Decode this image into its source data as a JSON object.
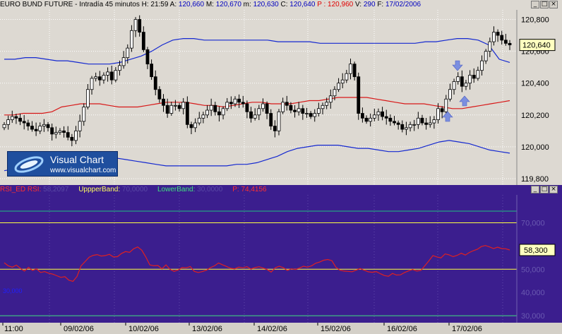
{
  "header": {
    "instrument": "EURO BUND FUTURE",
    "interval": "- Intradía 45 minutos",
    "h_label": "H:",
    "h_value": "21:59",
    "a_label": "A:",
    "a_value": "120,660",
    "mx_label": "M:",
    "mx_value": "120,670",
    "mn_label": "m:",
    "mn_value": "120,630",
    "c_label": "C:",
    "c_value": "120,640",
    "p_label": "P :",
    "p_value": "120,960",
    "v_label": "V:",
    "v_value": "290",
    "f_label": "F:",
    "f_value": "17/02/2006"
  },
  "window_buttons": [
    "_",
    "□",
    "×"
  ],
  "price_axis": {
    "ticks": [
      "120,800",
      "120,600",
      "120,400",
      "120,200",
      "120,000",
      "119,800"
    ],
    "last": "120,640"
  },
  "rsi_header": {
    "name": "RSI_ED",
    "rsi_label": "RSI:",
    "rsi_value": "58,2097",
    "upper_label": "UppperBand:",
    "upper_value": "70,0000",
    "lower_label": "LowerBand:",
    "lower_value": "30,0000",
    "p_label": "P:",
    "p_value": "74,4156"
  },
  "rsi_axis": {
    "ticks": [
      "70,000",
      "50,000",
      "40,000",
      "30,000"
    ],
    "last": "58,300"
  },
  "rsi_side_label": "30,000",
  "x_axis": {
    "labels": [
      "11:00",
      "09/02/06",
      "10/02/06",
      "13/02/06",
      "14/02/06",
      "15/02/06",
      "16/02/06",
      "17/02/06"
    ]
  },
  "logo": {
    "name": "Visual Chart",
    "url": "www.visualchart.com"
  },
  "colors": {
    "upper_band": "#1428d0",
    "mid_band": "#d81818",
    "rsi_line": "#e02020",
    "rsi_bg": "#3b1e8e",
    "up_arrow": "#7b8fe0"
  },
  "chart_data": [
    {
      "type": "candlestick",
      "title": "EURO BUND FUTURE - Intradía 45 minutos",
      "ylim": [
        119.76,
        120.86
      ],
      "series": [
        {
          "name": "price",
          "values": [
            120.14,
            120.17,
            120.19,
            120.18,
            120.16,
            120.15,
            120.13,
            120.11,
            120.1,
            120.13,
            120.14,
            120.12,
            120.08,
            120.09,
            120.1,
            120.09,
            120.06,
            120.04,
            120.1,
            120.16,
            120.25,
            120.36,
            120.43,
            120.44,
            120.42,
            120.45,
            120.47,
            120.42,
            120.48,
            120.51,
            120.56,
            120.62,
            120.73,
            120.8,
            120.72,
            120.61,
            120.52,
            120.44,
            120.36,
            120.3,
            120.26,
            120.21,
            120.26,
            120.26,
            120.24,
            120.28,
            120.14,
            120.12,
            120.15,
            120.18,
            120.2,
            120.23,
            120.26,
            120.22,
            120.2,
            120.24,
            120.28,
            120.27,
            120.3,
            120.28,
            120.27,
            120.22,
            120.18,
            120.2,
            120.24,
            120.27,
            120.21,
            120.13,
            120.1,
            120.22,
            120.28,
            120.26,
            120.23,
            120.22,
            120.24,
            120.21,
            120.21,
            120.19,
            120.21,
            120.24,
            120.26,
            120.28,
            120.32,
            120.36,
            120.4,
            120.42,
            120.46,
            120.52,
            120.44,
            120.21,
            120.18,
            120.16,
            120.18,
            120.2,
            120.22,
            120.19,
            120.18,
            120.16,
            120.15,
            120.14,
            120.11,
            120.12,
            120.14,
            120.14,
            120.18,
            120.15,
            120.14,
            120.15,
            120.17,
            120.24,
            120.22,
            120.3,
            120.36,
            120.41,
            120.44,
            120.38,
            120.4,
            120.45,
            120.43,
            120.48,
            120.54,
            120.6,
            120.66,
            120.72,
            120.7,
            120.67,
            120.65,
            120.64
          ]
        },
        {
          "name": "upper_band",
          "values": [
            120.55,
            120.55,
            120.56,
            120.56,
            120.55,
            120.54,
            120.54,
            120.53,
            120.52,
            120.52,
            120.52,
            120.53,
            120.55,
            120.57,
            120.6,
            120.64,
            120.67,
            120.68,
            120.68,
            120.67,
            120.67,
            120.67,
            120.67,
            120.67,
            120.67,
            120.67,
            120.66,
            120.66,
            120.66,
            120.66,
            120.65,
            120.65,
            120.65,
            120.65,
            120.65,
            120.65,
            120.65,
            120.65,
            120.65,
            120.65,
            120.66,
            120.66,
            120.67,
            120.68,
            120.68,
            120.67,
            120.64,
            120.55,
            120.53
          ]
        },
        {
          "name": "mid_band",
          "values": [
            120.2,
            120.2,
            120.21,
            120.21,
            120.21,
            120.22,
            120.25,
            120.26,
            120.27,
            120.27,
            120.27,
            120.26,
            120.25,
            120.25,
            120.25,
            120.26,
            120.27,
            120.28,
            120.28,
            120.28,
            120.27,
            120.26,
            120.26,
            120.25,
            120.26,
            120.27,
            120.28,
            120.28,
            120.27,
            120.27,
            120.27,
            120.28,
            120.29,
            120.29,
            120.3,
            120.31,
            120.31,
            120.31,
            120.31,
            120.3,
            120.29,
            120.28,
            120.27,
            120.27,
            120.27,
            120.26,
            120.25,
            120.24,
            120.24,
            120.25,
            120.26,
            120.27,
            120.28,
            120.29
          ]
        },
        {
          "name": "lower_band",
          "values": [
            119.85,
            119.86,
            119.87,
            119.88,
            119.89,
            119.9,
            119.91,
            119.92,
            119.93,
            119.94,
            119.94,
            119.93,
            119.92,
            119.91,
            119.9,
            119.89,
            119.88,
            119.88,
            119.88,
            119.88,
            119.88,
            119.88,
            119.88,
            119.89,
            119.89,
            119.9,
            119.92,
            119.94,
            119.97,
            119.99,
            120.0,
            120.01,
            120.01,
            120.01,
            120.0,
            119.99,
            119.99,
            119.98,
            119.97,
            119.97,
            119.98,
            119.99,
            120.01,
            120.03,
            120.04,
            120.03,
            120.02,
            120.0,
            119.98,
            119.97,
            119.96
          ]
        }
      ]
    },
    {
      "type": "line",
      "title": "RSI_ED",
      "ylim": [
        27,
        82
      ],
      "series": [
        {
          "name": "RSI",
          "values": [
            52.8,
            51.5,
            50.9,
            51.8,
            50.4,
            49.2,
            50.8,
            49.5,
            50.2,
            48.6,
            49.0,
            48.3,
            47.9,
            47.2,
            46.5,
            46.8,
            45.3,
            44.8,
            46.9,
            51.5,
            53.3,
            55.2,
            56.0,
            56.3,
            55.7,
            55.9,
            56.4,
            55.3,
            55.4,
            56.8,
            57.6,
            57.3,
            58.8,
            59.6,
            58.2,
            55.3,
            51.9,
            51.5,
            51.6,
            50.2,
            51.9,
            50.0,
            49.1,
            49.7,
            50.7,
            50.6,
            51.2,
            49.1,
            48.6,
            49.0,
            49.6,
            50.7,
            51.5,
            52.7,
            51.9,
            51.2,
            50.4,
            50.2,
            50.9,
            50.6,
            51.1,
            50.1,
            50.7,
            51.1,
            50.5,
            49.9,
            48.8,
            50.6,
            51.3,
            50.7,
            49.5,
            50.2,
            49.9,
            50.5,
            51.3,
            50.9,
            51.5,
            52.6,
            53.1,
            53.9,
            54.2,
            53.7,
            50.9,
            49.6,
            49.2,
            49.1,
            48.9,
            49.6,
            50.3,
            49.6,
            48.9,
            48.7,
            49.0,
            48.1,
            47.3,
            47.0,
            48.2,
            47.5,
            47.6,
            48.6,
            49.3,
            49.9,
            49.2,
            49.5,
            51.5,
            53.6,
            55.9,
            55.3,
            54.9,
            56.6,
            56.2,
            55.4,
            56.0,
            56.9,
            56.1,
            57.2,
            58.0,
            58.6,
            59.8,
            60.2,
            59.6,
            58.9,
            59.5,
            58.9,
            58.8,
            58.3
          ]
        },
        {
          "name": "UppperBand",
          "values": [
            70.0,
            70.0
          ]
        },
        {
          "name": "LowerBand",
          "values": [
            30.0,
            30.0
          ]
        }
      ]
    }
  ]
}
